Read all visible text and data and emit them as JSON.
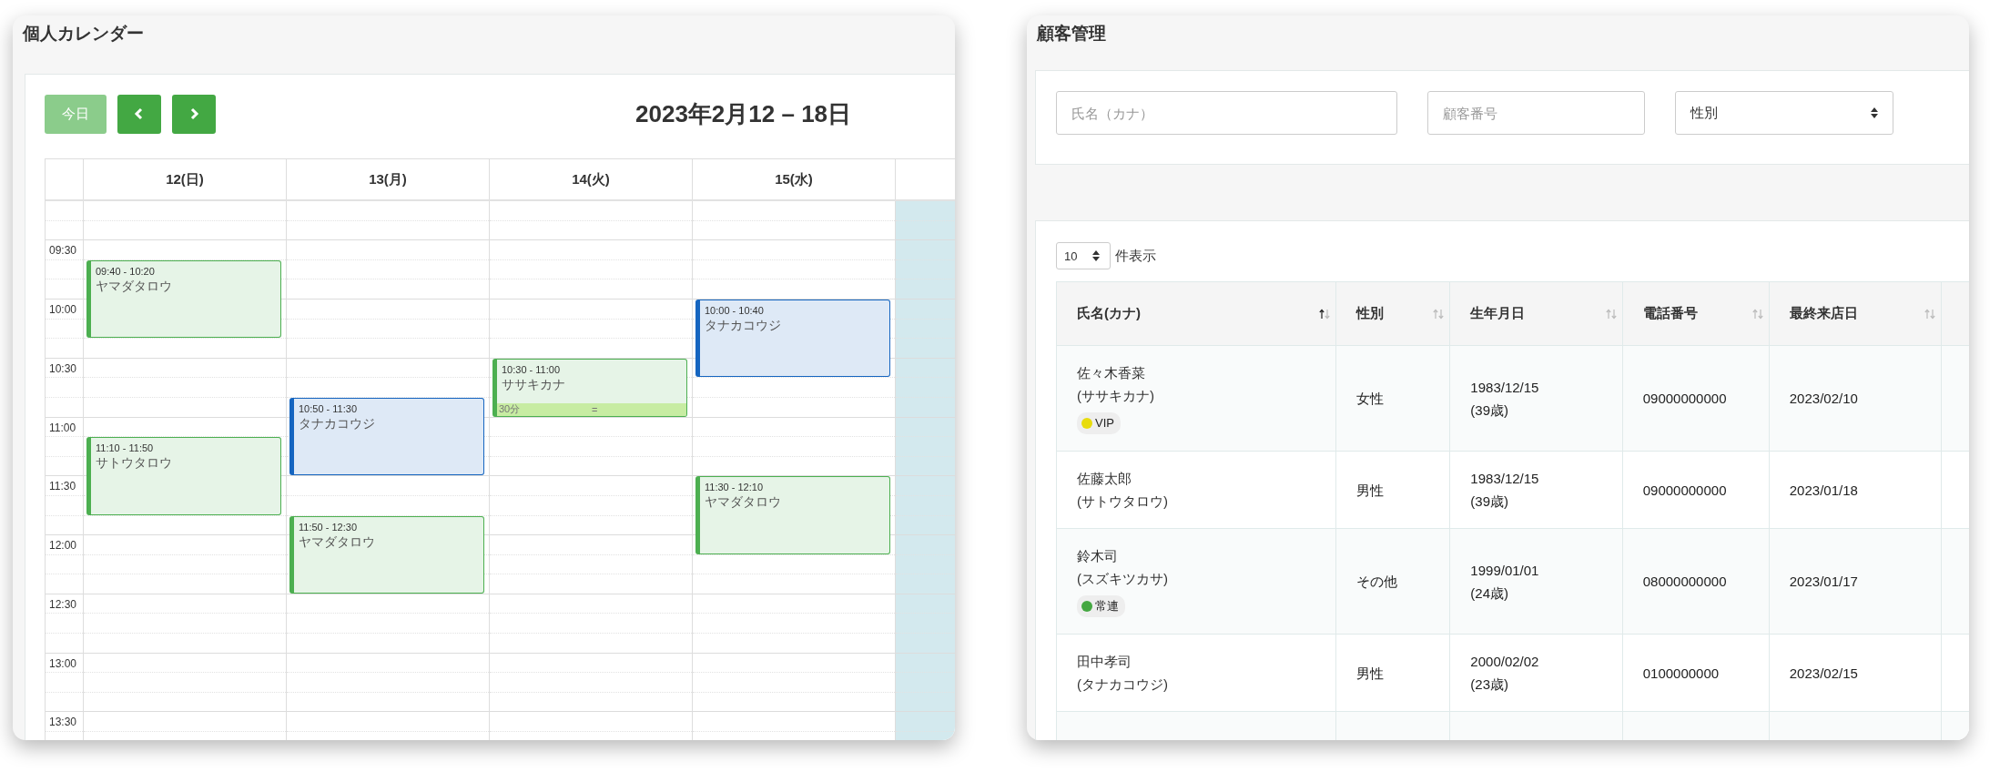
{
  "calendar": {
    "title": "個人カレンダー",
    "today_button": {
      "label": "今日",
      "disabled": true
    },
    "range_title": "2023年2月12 – 18日",
    "times": [
      "09:30",
      "10:00",
      "10:30",
      "11:00",
      "11:30",
      "12:00",
      "12:30",
      "13:00",
      "13:30"
    ],
    "days": [
      {
        "label": "12(日)",
        "today": false,
        "events": [
          {
            "time": "09:40 - 10:20",
            "name": "ヤマダタロウ",
            "color": "#4caf50",
            "selected": false
          },
          {
            "time": "11:10 - 11:50",
            "name": "サトウタロウ",
            "color": "#4caf50",
            "selected": false
          }
        ]
      },
      {
        "label": "13(月)",
        "today": false,
        "events": [
          {
            "time": "10:50 - 11:30",
            "name": "タナカコウジ",
            "color": "#1565c0",
            "selected": false
          },
          {
            "time": "11:50 - 12:30",
            "name": "ヤマダタロウ",
            "color": "#4caf50",
            "selected": false
          }
        ]
      },
      {
        "label": "14(火)",
        "today": false,
        "events": [
          {
            "time": "10:30 - 11:00",
            "name": "ササキカナ",
            "color": "#4caf50",
            "selected": true,
            "duration": "30分",
            "handle": "="
          }
        ]
      },
      {
        "label": "15(水)",
        "today": false,
        "events": [
          {
            "time": "10:00 - 10:40",
            "name": "タナカコウジ",
            "color": "#1565c0",
            "selected": false
          },
          {
            "time": "11:30 - 12:10",
            "name": "ヤマダタロウ",
            "color": "#4caf50",
            "selected": false
          }
        ]
      },
      {
        "today": true
      }
    ]
  },
  "customers": {
    "title": "顧客管理",
    "filters": {
      "name_placeholder": "氏名（カナ）",
      "number_placeholder": "顧客番号",
      "gender_select": "性別"
    },
    "page_size": "10",
    "page_size_label": "件表示",
    "columns": [
      {
        "label": "氏名(カナ)",
        "sorted": true
      },
      {
        "label": "性別",
        "sorted": false
      },
      {
        "label": "生年月日",
        "sorted": false
      },
      {
        "label": "電話番号",
        "sorted": false
      },
      {
        "label": "最終来店日",
        "sorted": false
      }
    ],
    "rows": [
      {
        "name": "佐々木香菜",
        "kana": "(ササキカナ)",
        "tag": {
          "label": "VIP",
          "color": "#e8dc0c"
        },
        "gender": "女性",
        "birth": "1983/12/15",
        "age": "(39歳)",
        "phone": "09000000000",
        "last_visit": "2023/02/10"
      },
      {
        "name": "佐藤太郎",
        "kana": "(サトウタロウ)",
        "gender": "男性",
        "birth": "1983/12/15",
        "age": "(39歳)",
        "phone": "09000000000",
        "last_visit": "2023/01/18"
      },
      {
        "name": "鈴木司",
        "kana": "(スズキツカサ)",
        "tag": {
          "label": "常連",
          "color": "#45a842"
        },
        "gender": "その他",
        "birth": "1999/01/01",
        "age": "(24歳)",
        "phone": "08000000000",
        "last_visit": "2023/01/17"
      },
      {
        "name": "田中孝司",
        "kana": "(タナカコウジ)",
        "gender": "男性",
        "birth": "2000/02/02",
        "age": "(23歳)",
        "phone": "0100000000",
        "last_visit": "2023/02/15"
      }
    ]
  }
}
